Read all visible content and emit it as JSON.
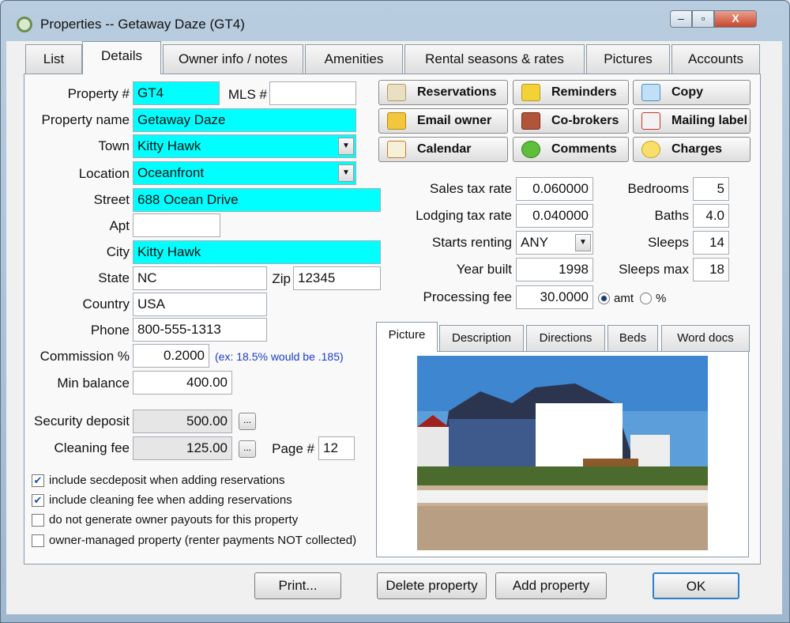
{
  "window": {
    "title": "Properties -- Getaway Daze (GT4)",
    "min": "–",
    "max": "▫",
    "close": "X"
  },
  "tabs": [
    "List",
    "Details",
    "Owner info / notes",
    "Amenities",
    "Rental seasons & rates",
    "Pictures",
    "Accounts"
  ],
  "form": {
    "property_num": {
      "label": "Property #",
      "value": "GT4"
    },
    "mls": {
      "label": "MLS #",
      "value": ""
    },
    "property_name": {
      "label": "Property name",
      "value": "Getaway Daze"
    },
    "town": {
      "label": "Town",
      "value": "Kitty Hawk"
    },
    "location": {
      "label": "Location",
      "value": "Oceanfront"
    },
    "street": {
      "label": "Street",
      "value": "688 Ocean Drive"
    },
    "apt": {
      "label": "Apt",
      "value": ""
    },
    "city": {
      "label": "City",
      "value": "Kitty Hawk"
    },
    "state": {
      "label": "State",
      "value": "NC"
    },
    "zip": {
      "label": "Zip",
      "value": "12345"
    },
    "country": {
      "label": "Country",
      "value": "USA"
    },
    "phone": {
      "label": "Phone",
      "value": "800-555-1313"
    },
    "commission": {
      "label": "Commission %",
      "value": "0.2000",
      "hint": "(ex: 18.5% would be .185)"
    },
    "min_balance": {
      "label": "Min balance",
      "value": "400.00"
    },
    "security_deposit": {
      "label": "Security deposit",
      "value": "500.00"
    },
    "cleaning_fee": {
      "label": "Cleaning fee",
      "value": "125.00"
    },
    "page_num": {
      "label": "Page #",
      "value": "12"
    },
    "ellipsis": "..."
  },
  "checkboxes": [
    {
      "label": "include secdeposit when adding reservations",
      "checked": true
    },
    {
      "label": "include cleaning fee when adding reservations",
      "checked": true
    },
    {
      "label": "do not generate owner payouts for this property",
      "checked": false
    },
    {
      "label": "owner-managed property (renter payments NOT collected)",
      "checked": false
    }
  ],
  "toolbar": [
    "Reservations",
    "Reminders",
    "Copy",
    "Email owner",
    "Co-brokers",
    "Mailing label",
    "Calendar",
    "Comments",
    "Charges"
  ],
  "rates": {
    "sales_tax": {
      "label": "Sales tax rate",
      "value": "0.060000"
    },
    "lodging_tax": {
      "label": "Lodging tax rate",
      "value": "0.040000"
    },
    "starts_renting": {
      "label": "Starts renting",
      "value": "ANY"
    },
    "year_built": {
      "label": "Year built",
      "value": "1998"
    },
    "processing_fee": {
      "label": "Processing fee",
      "value": "30.0000"
    },
    "amt": "amt",
    "pct": "%"
  },
  "specs": {
    "bedrooms": {
      "label": "Bedrooms",
      "value": "5"
    },
    "baths": {
      "label": "Baths",
      "value": "4.0"
    },
    "sleeps": {
      "label": "Sleeps",
      "value": "14"
    },
    "sleeps_max": {
      "label": "Sleeps max",
      "value": "18"
    }
  },
  "picture_tabs": [
    "Picture",
    "Description",
    "Directions",
    "Beds",
    "Word docs"
  ],
  "buttons": {
    "print": "Print...",
    "delete": "Delete property",
    "add": "Add property",
    "ok": "OK"
  }
}
